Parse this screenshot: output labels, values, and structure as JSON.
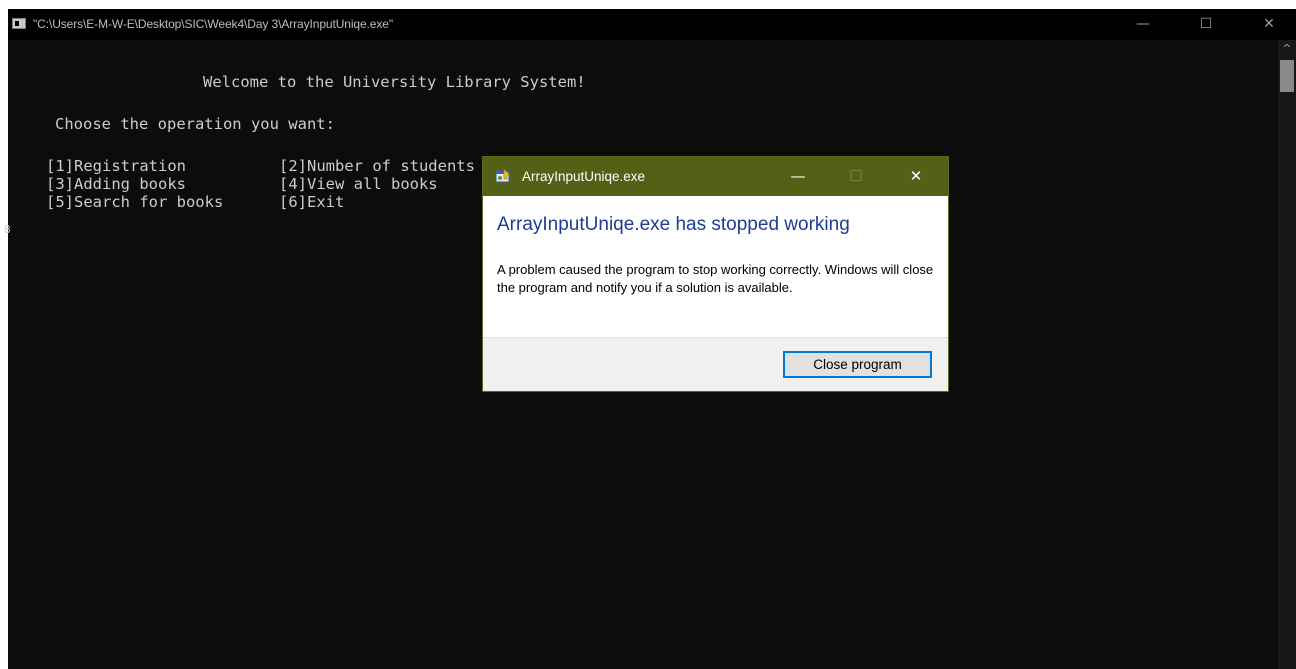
{
  "window": {
    "title": "\"C:\\Users\\E-M-W-E\\Desktop\\SIC\\Week4\\Day 3\\ArrayInputUniqe.exe\"",
    "minimize_glyph": "—",
    "maximize_glyph": "☐",
    "close_glyph": "✕"
  },
  "console": {
    "welcome": "Welcome to the University Library System!",
    "prompt": "Choose the operation you want:",
    "menu": [
      "[1]Registration",
      "[2]Number of students",
      "[3]Adding books",
      "[4]View all books",
      "[5]Search for books",
      "[6]Exit"
    ],
    "cursor": "8"
  },
  "scrollbar": {
    "up_glyph": "^"
  },
  "dialog": {
    "title": "ArrayInputUniqe.exe",
    "heading": "ArrayInputUniqe.exe has stopped working",
    "message": "A problem caused the program to stop working correctly. Windows will close the program and notify you if a solution is available.",
    "close_button": "Close program",
    "minimize_glyph": "—",
    "maximize_glyph": "☐",
    "close_glyph": "✕"
  },
  "colors": {
    "console_background": "#0c0c0c",
    "console_text": "#cccccc",
    "dialog_titlebar": "#536117",
    "dialog_heading": "#1e3c96",
    "button_focus_border": "#0078d7"
  }
}
